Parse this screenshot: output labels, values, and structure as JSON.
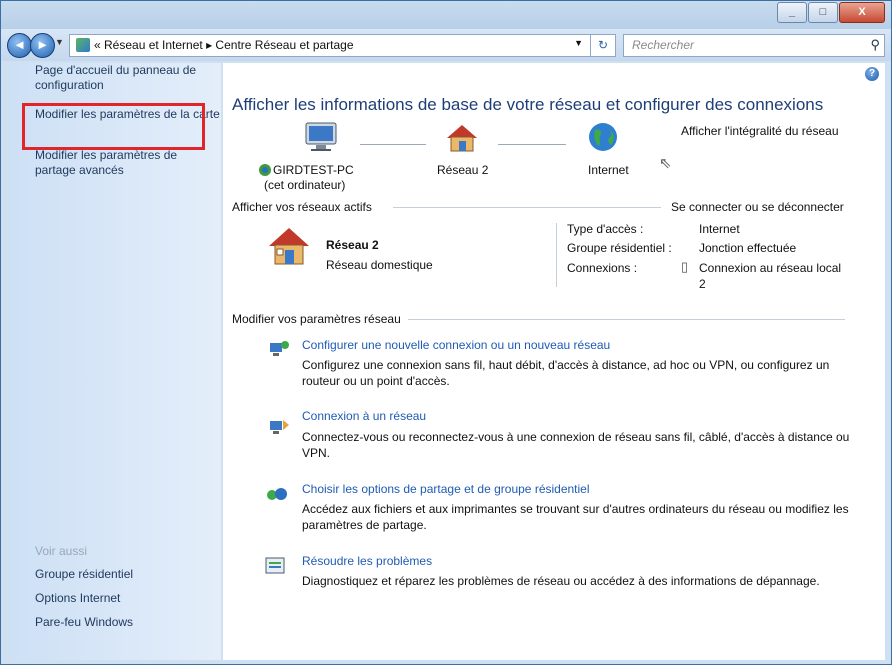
{
  "window": {
    "buttons": {
      "minimize": "_",
      "maximize": "□",
      "close": "X"
    }
  },
  "navbar": {
    "address_crumbs": "«  Réseau et Internet  ▸  Centre Réseau et partage",
    "search_placeholder": "Rechercher"
  },
  "sidebar": {
    "items": [
      {
        "label": "Page d'accueil du panneau de configuration"
      },
      {
        "label": "Modifier les paramètres de la carte"
      },
      {
        "label": "Modifier les paramètres de partage avancés"
      }
    ],
    "see_also_label": "Voir aussi",
    "see_also": [
      {
        "label": "Groupe résidentiel"
      },
      {
        "label": "Options Internet"
      },
      {
        "label": "Pare-feu Windows"
      }
    ]
  },
  "main": {
    "title": "Afficher les informations de base de votre réseau et configurer des connexions",
    "view_full_map": "Afficher l'intégralité du réseau",
    "map": {
      "computer_name": "GIRDTEST-PC",
      "computer_sub": "(cet ordinateur)",
      "network_name": "Réseau 2",
      "internet_label": "Internet"
    },
    "active_networks": {
      "header": "Afficher vos réseaux actifs",
      "connect_link": "Se connecter ou se déconnecter",
      "network_name": "Réseau 2",
      "network_type": "Réseau domestique",
      "access_type_label": "Type d'accès :",
      "access_type_value": "Internet",
      "homegroup_label": "Groupe résidentiel :",
      "homegroup_value": "Jonction effectuée",
      "connections_label": "Connexions :",
      "connections_value_1": "Connexion au réseau local",
      "connections_value_2": "2"
    },
    "settings": {
      "header": "Modifier vos paramètres réseau",
      "tasks": [
        {
          "title": "Configurer une nouvelle connexion ou un nouveau réseau",
          "desc": "Configurez une connexion sans fil, haut débit, d'accès à distance, ad hoc ou VPN, ou configurez un routeur ou un point d'accès."
        },
        {
          "title": "Connexion à un réseau",
          "desc": "Connectez-vous ou reconnectez-vous à une connexion de réseau sans fil, câblé, d'accès à distance ou VPN."
        },
        {
          "title": "Choisir les options de partage et de groupe résidentiel",
          "desc": "Accédez aux fichiers et aux imprimantes se trouvant sur d'autres ordinateurs du réseau ou modifiez les paramètres de partage."
        },
        {
          "title": "Résoudre les problèmes",
          "desc": "Diagnostiquez et réparez les problèmes de réseau ou accédez à des informations de dépannage."
        }
      ]
    }
  }
}
